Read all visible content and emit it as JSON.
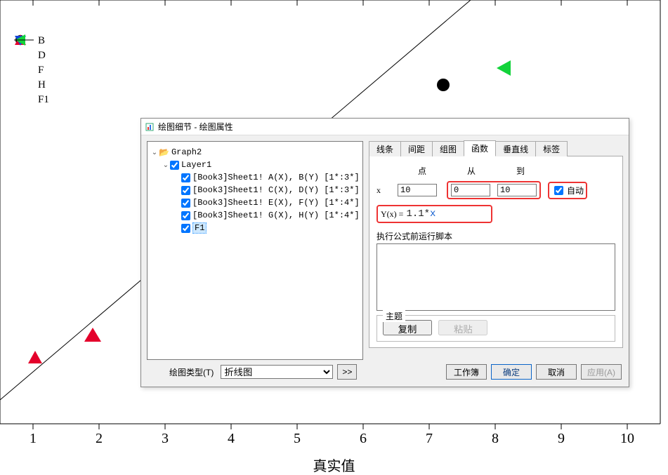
{
  "chart_data": {
    "type": "scatter",
    "xlabel": "真实值",
    "x_ticks": [
      1,
      2,
      3,
      4,
      5,
      6,
      7,
      8,
      9,
      10
    ],
    "series": [
      {
        "name": "B",
        "marker": "circle-black",
        "points": [
          [
            8,
            9.5
          ]
        ]
      },
      {
        "name": "D",
        "marker": "triangle-red",
        "points": [
          [
            0.6,
            1.3
          ],
          [
            2,
            3.4
          ]
        ]
      },
      {
        "name": "F",
        "marker": "triangle-blue-down",
        "points": []
      },
      {
        "name": "H",
        "marker": "triangle-green-left",
        "points": [
          [
            9,
            10
          ]
        ]
      },
      {
        "name": "F1",
        "type": "line",
        "formula": "1.1*x",
        "x_range": [
          0,
          10
        ]
      }
    ]
  },
  "legend": {
    "items": [
      {
        "label": "B"
      },
      {
        "label": "D"
      },
      {
        "label": "F"
      },
      {
        "label": "H"
      },
      {
        "label": "F1"
      }
    ]
  },
  "xticks": {
    "t1": "1",
    "t2": "2",
    "t3": "3",
    "t4": "4",
    "t5": "5",
    "t6": "6",
    "t7": "7",
    "t8": "8",
    "t9": "9",
    "t10": "10"
  },
  "xtitle": "真实值",
  "dialog": {
    "title": "绘图细节 - 绘图属性",
    "tree": {
      "root": "Graph2",
      "layer": "Layer1",
      "items": [
        "[Book3]Sheet1! A(X), B(Y) [1*:3*]",
        "[Book3]Sheet1! C(X), D(Y) [1*:3*]",
        "[Book3]Sheet1! E(X), F(Y) [1*:4*]",
        "[Book3]Sheet1! G(X), H(Y) [1*:4*]",
        "F1"
      ]
    },
    "tabs": {
      "t0": "线条",
      "t1": "间距",
      "t2": "组图",
      "t3": "函数",
      "t4": "垂直线",
      "t5": "标签"
    },
    "func": {
      "hdr_point": "点",
      "hdr_from": "从",
      "hdr_to": "到",
      "row_x_label": "x",
      "points_val": "10",
      "from_val": "0",
      "to_val": "10",
      "auto_label": "自动",
      "yx_label": "Y(x) =",
      "yx_val": "1.1*x",
      "script_label": "执行公式前运行脚本",
      "theme_label": "主题",
      "copy": "复制",
      "paste": "粘贴"
    },
    "footer": {
      "plot_type_label": "绘图类型(T)",
      "plot_type_value": "折线图",
      "more": ">>",
      "workbook": "工作簿",
      "ok": "确定",
      "cancel": "取消",
      "apply": "应用(A)"
    }
  }
}
